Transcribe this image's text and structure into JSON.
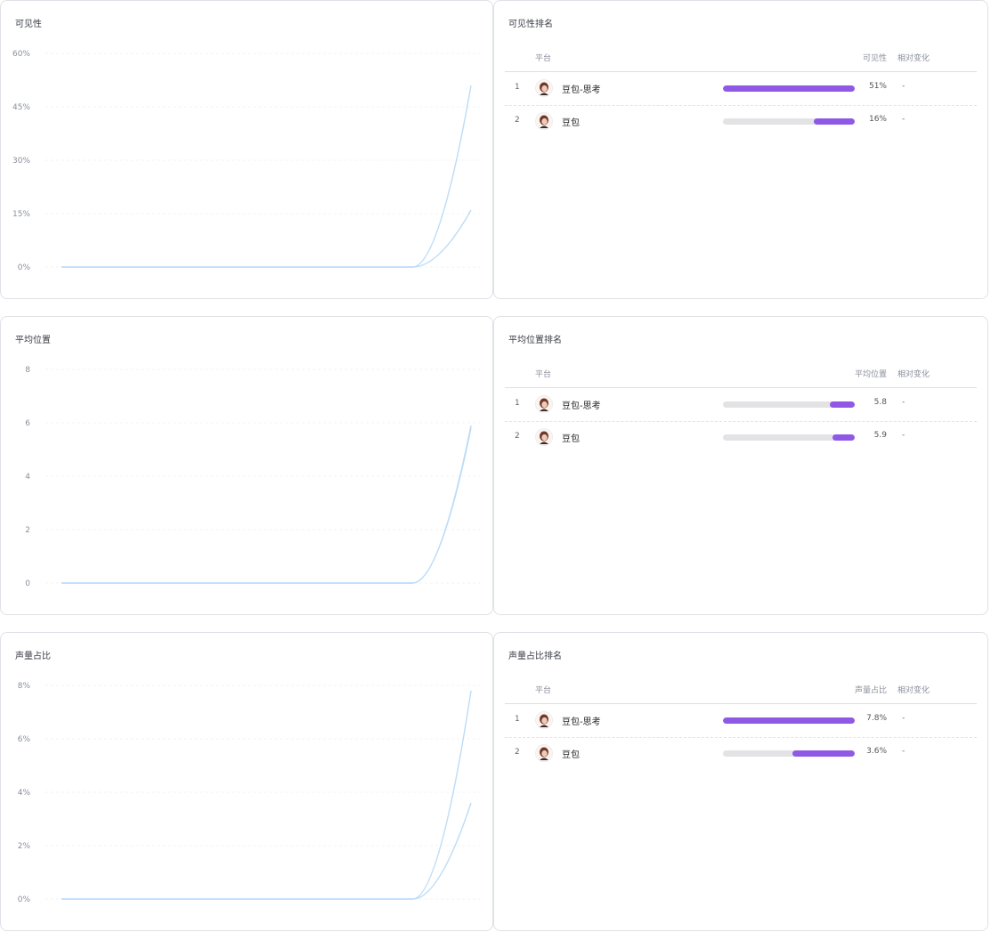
{
  "colors": {
    "accent": "#8f59e6",
    "track": "#e3e3e6",
    "line": "#bcdcf7"
  },
  "sections": [
    {
      "chart": {
        "title": "可见性",
        "chart_data": {
          "type": "line",
          "x": [
            0,
            1,
            2,
            3,
            4,
            5,
            6,
            7
          ],
          "yticks": [
            "60%",
            "45%",
            "30%",
            "15%",
            "0%"
          ],
          "ylim": [
            0,
            60
          ],
          "series": [
            {
              "values": [
                0,
                0,
                0,
                0,
                0,
                0,
                0,
                51
              ]
            },
            {
              "values": [
                0,
                0,
                0,
                0,
                0,
                0,
                0,
                16
              ]
            }
          ]
        }
      },
      "ranking": {
        "title": "可见性排名",
        "headers": {
          "platform": "平台",
          "metric": "可见性",
          "change": "相对变化"
        },
        "rows": [
          {
            "rank": "1",
            "name": "豆包-思考",
            "bar": 1.0,
            "value": "51%",
            "change": "-",
            "avatar": "avatar-icon"
          },
          {
            "rank": "2",
            "name": "豆包",
            "bar": 0.31,
            "value": "16%",
            "change": "-",
            "avatar": "avatar-icon"
          }
        ]
      }
    },
    {
      "chart": {
        "title": "平均位置",
        "chart_data": {
          "type": "line",
          "x": [
            0,
            1,
            2,
            3,
            4,
            5,
            6,
            7
          ],
          "yticks": [
            "8",
            "6",
            "4",
            "2",
            "0"
          ],
          "ylim": [
            0,
            8
          ],
          "series": [
            {
              "values": [
                0,
                0,
                0,
                0,
                0,
                0,
                0,
                5.8
              ]
            },
            {
              "values": [
                0,
                0,
                0,
                0,
                0,
                0,
                0,
                5.9
              ]
            }
          ]
        }
      },
      "ranking": {
        "title": "平均位置排名",
        "headers": {
          "platform": "平台",
          "metric": "平均位置",
          "change": "相对变化"
        },
        "rows": [
          {
            "rank": "1",
            "name": "豆包-思考",
            "bar": 0.19,
            "value": "5.8",
            "change": "-",
            "avatar": "avatar-icon"
          },
          {
            "rank": "2",
            "name": "豆包",
            "bar": 0.17,
            "value": "5.9",
            "change": "-",
            "avatar": "avatar-icon"
          }
        ]
      }
    },
    {
      "chart": {
        "title": "声量占比",
        "chart_data": {
          "type": "line",
          "x": [
            0,
            1,
            2,
            3,
            4,
            5,
            6,
            7
          ],
          "yticks": [
            "8%",
            "6%",
            "4%",
            "2%",
            "0%"
          ],
          "ylim": [
            0,
            8
          ],
          "series": [
            {
              "values": [
                0,
                0,
                0,
                0,
                0,
                0,
                0,
                7.8
              ]
            },
            {
              "values": [
                0,
                0,
                0,
                0,
                0,
                0,
                0,
                3.6
              ]
            }
          ]
        }
      },
      "ranking": {
        "title": "声量占比排名",
        "headers": {
          "platform": "平台",
          "metric": "声量占比",
          "change": "相对变化"
        },
        "rows": [
          {
            "rank": "1",
            "name": "豆包-思考",
            "bar": 1.0,
            "value": "7.8%",
            "change": "-",
            "avatar": "avatar-icon"
          },
          {
            "rank": "2",
            "name": "豆包",
            "bar": 0.47,
            "value": "3.6%",
            "change": "-",
            "avatar": "avatar-icon"
          }
        ]
      }
    }
  ]
}
